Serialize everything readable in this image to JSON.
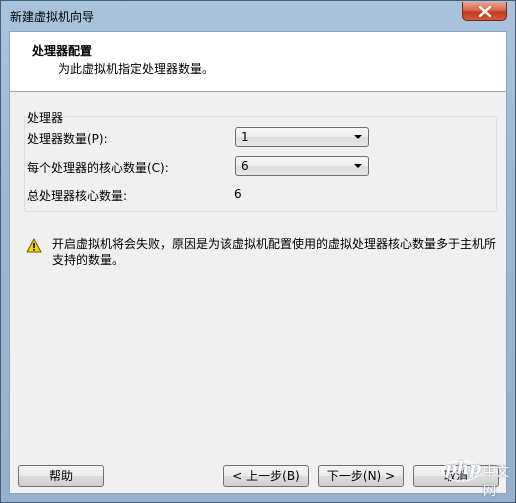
{
  "window": {
    "title": "新建虚拟机向导"
  },
  "header": {
    "title": "处理器配置",
    "subtitle": "为此虚拟机指定处理器数量。"
  },
  "processor_group": {
    "legend": "处理器",
    "processor_count_label": "处理器数量(P):",
    "processor_count_value": "1",
    "cores_per_processor_label": "每个处理器的核心数量(C):",
    "cores_per_processor_value": "6",
    "total_cores_label": "总处理器核心数量:",
    "total_cores_value": "6"
  },
  "warning": {
    "text": "开启虚拟机将会失败，原因是为该虚拟机配置使用的虚拟处理器核心数量多于主机所支持的数量。"
  },
  "buttons": {
    "help": "帮助",
    "back": "< 上一步(B)",
    "next": "下一步(N) >",
    "cancel": "取消"
  },
  "watermark": {
    "brand": "php",
    "site": "中文网"
  },
  "colors": {
    "title_bar": "#9bb7d3",
    "close_button": "#c23a22",
    "client_background": "#f0f0f0",
    "warning_icon": "#f5d20a"
  }
}
